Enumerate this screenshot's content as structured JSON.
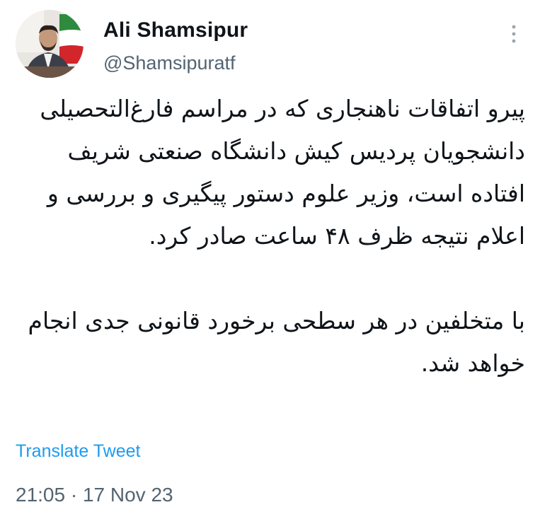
{
  "author": {
    "display_name": "Ali Shamsipur",
    "handle": "@Shamsipuratf"
  },
  "tweet": {
    "paragraphs": [
      "پیرو اتفاقات ناهنجاری که در مراسم فارغ‌التحصیلی دانشجویان پردیس کیش دانشگاه صنعتی شریف افتاده است، وزیر علوم دستور پیگیری و بررسی و اعلام نتیجه ظرف ۴۸ ساعت صادر کرد.",
      "با متخلفین در هر سطحی برخورد قانونی جدی انجام خواهد شد."
    ],
    "translate_label": "Translate Tweet",
    "timestamp": "21:05 · 17 Nov 23"
  },
  "icons": {
    "more": "more-vertical-icon",
    "avatar": "avatar"
  },
  "colors": {
    "text_primary": "#0f1419",
    "text_secondary": "#536471",
    "link": "#1d9bf0",
    "background": "#ffffff"
  }
}
